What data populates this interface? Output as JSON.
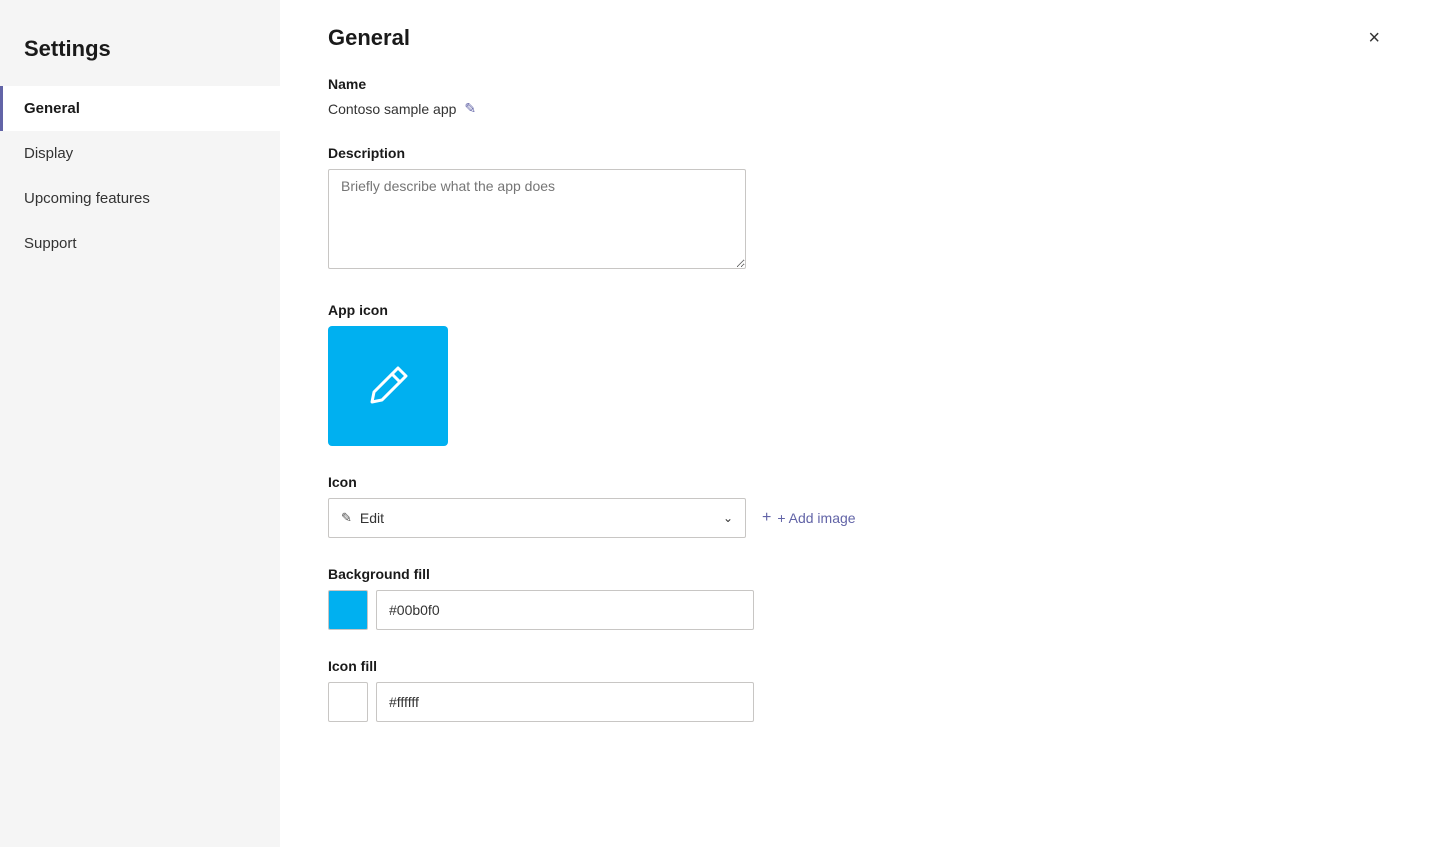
{
  "sidebar": {
    "title": "Settings",
    "items": [
      {
        "id": "general",
        "label": "General",
        "active": true
      },
      {
        "id": "display",
        "label": "Display",
        "active": false
      },
      {
        "id": "upcoming-features",
        "label": "Upcoming features",
        "active": false
      },
      {
        "id": "support",
        "label": "Support",
        "active": false
      }
    ]
  },
  "main": {
    "title": "General",
    "close_label": "×",
    "sections": {
      "name": {
        "label": "Name",
        "value": "Contoso sample app",
        "edit_icon": "✎"
      },
      "description": {
        "label": "Description",
        "placeholder": "Briefly describe what the app does"
      },
      "app_icon": {
        "label": "App icon",
        "icon_color": "#00b0f0"
      },
      "icon": {
        "label": "Icon",
        "selected": "Edit",
        "add_image_label": "+ Add image"
      },
      "background_fill": {
        "label": "Background fill",
        "color": "#00b0f0",
        "color_value": "#00b0f0"
      },
      "icon_fill": {
        "label": "Icon fill",
        "color": "#ffffff",
        "color_value": "#ffffff"
      }
    }
  },
  "icons": {
    "pencil": "✎",
    "chevron_down": "⌄",
    "plus": "+",
    "close": "✕"
  }
}
